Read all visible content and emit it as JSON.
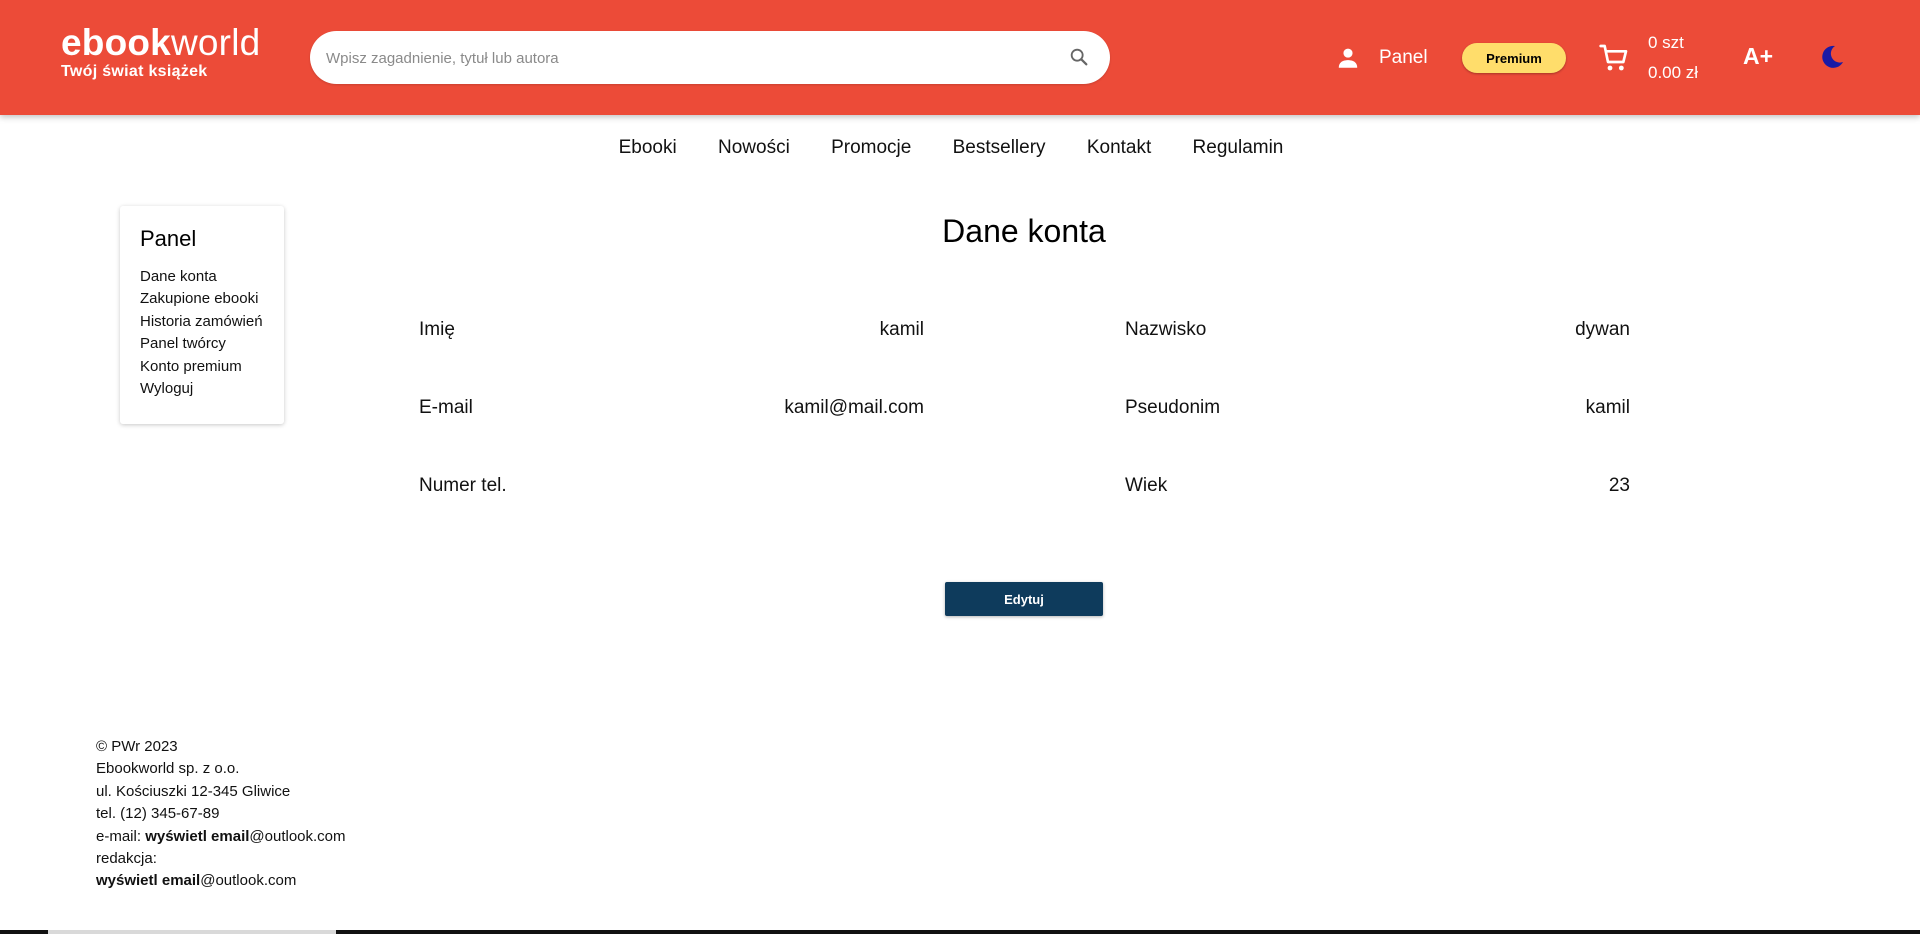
{
  "header": {
    "brand_bold": "ebook",
    "brand_light": "world",
    "tagline": "Twój świat książek",
    "search_placeholder": "Wpisz zagadnienie, tytuł lub autora",
    "user_label": "Panel",
    "premium_label": "Premium",
    "cart_count": "0 szt",
    "cart_total": "0.00 zł",
    "font_size_label": "A+",
    "icons": {
      "search": "search-icon",
      "user": "person-icon",
      "cart": "cart-icon",
      "theme": "moon-icon"
    },
    "colors": {
      "header_bg": "#ec4b38",
      "premium_bg": "#ffdd6b",
      "moon": "#1a1aa6"
    }
  },
  "nav": {
    "items": [
      "Ebooki",
      "Nowości",
      "Promocje",
      "Bestsellery",
      "Kontakt",
      "Regulamin"
    ]
  },
  "sidebar": {
    "title": "Panel",
    "items": [
      "Dane konta",
      "Zakupione ebooki",
      "Historia zamówień",
      "Panel twórcy",
      "Konto premium",
      "Wyloguj"
    ]
  },
  "main": {
    "title": "Dane konta",
    "fields": [
      {
        "label": "Imię",
        "value": "kamil"
      },
      {
        "label": "Nazwisko",
        "value": "dywan"
      },
      {
        "label": "E-mail",
        "value": "kamil@mail.com"
      },
      {
        "label": "Pseudonim",
        "value": "kamil"
      },
      {
        "label": "Numer tel.",
        "value": ""
      },
      {
        "label": "Wiek",
        "value": "23"
      }
    ],
    "edit_label": "Edytuj",
    "edit_color": "#0e3b5c"
  },
  "footer": {
    "copyright": "© PWr 2023",
    "company": "Ebookworld sp. z o.o.",
    "address": "ul. Kościuszki 12-345 Gliwice",
    "phone": "tel. (12) 345-67-89",
    "email_prefix": "e-mail: ",
    "email_reveal": "wyświetl email",
    "email_domain": "@outlook.com",
    "editorial_label": "redakcja:",
    "editorial_reveal": "wyświetl email",
    "editorial_domain": "@outlook.com"
  }
}
